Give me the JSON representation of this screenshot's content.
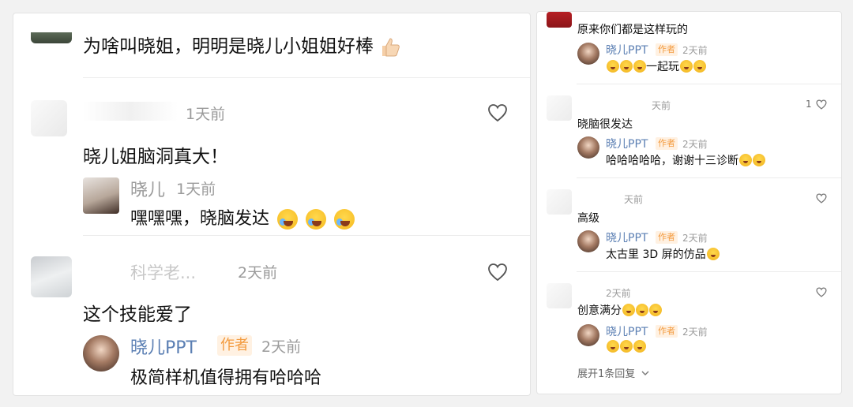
{
  "left_thread": {
    "comments": [
      {
        "text": "为啥叫晓姐，明明是晓儿小姐姐好棒",
        "emoji_icon": "thumbs-up-icon"
      },
      {
        "user": "",
        "time": "1天前",
        "text": "晓儿姐脑洞真大！",
        "reply": {
          "user": "晓儿",
          "time": "1天前",
          "text": "嘿嘿嘿，晓脑发达",
          "emoji_icons": [
            "crying-laughing-icon",
            "crying-laughing-icon",
            "crying-laughing-icon"
          ]
        }
      },
      {
        "user": "科学老...",
        "time": "2天前",
        "text": "这个技能爱了",
        "reply": {
          "user": "晓儿PPT",
          "author_tag": "作者",
          "time": "2天前",
          "text": "极简样机值得拥有哈哈哈"
        }
      }
    ]
  },
  "right_thread": {
    "comments": [
      {
        "text": "原来你们都是这样玩的",
        "reply": {
          "user": "晓儿PPT",
          "author_tag": "作者",
          "time": "2天前",
          "text": "一起玩"
        }
      },
      {
        "time": "天前",
        "likes": "1",
        "text": "晓脑很发达",
        "reply": {
          "user": "晓儿PPT",
          "author_tag": "作者",
          "time": "2天前",
          "text": "哈哈哈哈哈，谢谢十三诊断"
        }
      },
      {
        "time": "天前",
        "text": "高级",
        "reply": {
          "user": "晓儿PPT",
          "author_tag": "作者",
          "time": "2天前",
          "text": "太古里 3D 屏的仿品"
        }
      },
      {
        "time": "2天前",
        "text": "创意满分",
        "reply": {
          "user": "晓儿PPT",
          "author_tag": "作者",
          "time": "2天前",
          "text": ""
        },
        "expand_label": "展开1条回复"
      }
    ]
  },
  "colors": {
    "accent_name": "#5b7fb3",
    "author_tag": "#f39b3f",
    "meta_gray": "#9b9b9b"
  }
}
